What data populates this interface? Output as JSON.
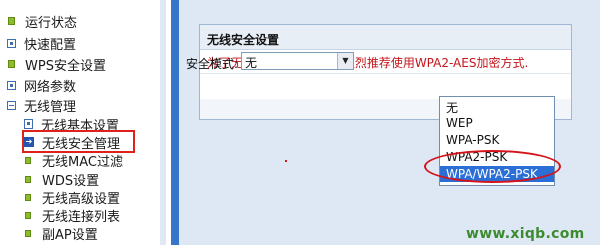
{
  "sidebar": {
    "items": [
      {
        "label": "运行状态"
      },
      {
        "label": "快速配置"
      },
      {
        "label": "WPS安全设置"
      },
      {
        "label": "网络参数"
      },
      {
        "label": "无线管理"
      }
    ],
    "sub_items": [
      {
        "label": "无线基本设置"
      },
      {
        "label": "无线安全管理"
      },
      {
        "label": "无线MAC过滤"
      },
      {
        "label": "WDS设置"
      },
      {
        "label": "无线高级设置"
      },
      {
        "label": "无线连接列表"
      },
      {
        "label": "副AP设置"
      }
    ]
  },
  "panel": {
    "title": "无线安全设置",
    "notice": "为了无线网络的安全,我们强烈推荐使用WPA2-AES加密方式.",
    "security_mode_label": "安全模式:",
    "security_mode_value": "无"
  },
  "dropdown": {
    "options": [
      "无",
      "WEP",
      "WPA-PSK",
      "WPA2-PSK",
      "WPA/WPA2-PSK"
    ],
    "selected": "WPA/WPA2-PSK"
  },
  "watermark": "www.xiqb.com",
  "colors": {
    "highlight": "#e0211b",
    "selection": "#2b6fd6",
    "notice_text": "#c4151b",
    "panel_bg": "#dde8f4"
  }
}
